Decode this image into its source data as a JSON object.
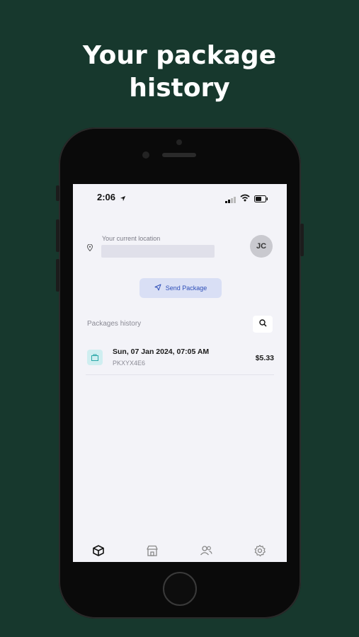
{
  "headline": [
    "Your package",
    "history"
  ],
  "status_bar": {
    "time": "2:06"
  },
  "location": {
    "label": "Your current location",
    "value": ""
  },
  "user": {
    "initials": "JC"
  },
  "send_button": {
    "label": "Send Package"
  },
  "packages": {
    "title": "Packages history",
    "items": [
      {
        "date": "Sun, 07 Jan 2024, 07:05 AM",
        "code": "PKXYX4E6",
        "price": "$5.33"
      }
    ]
  },
  "colors": {
    "background": "#17382d",
    "accent": "#2f4fb8",
    "package_icon_bg": "#cfeef0"
  },
  "tab_icons": [
    "box-icon",
    "store-icon",
    "users-icon",
    "gear-icon"
  ]
}
